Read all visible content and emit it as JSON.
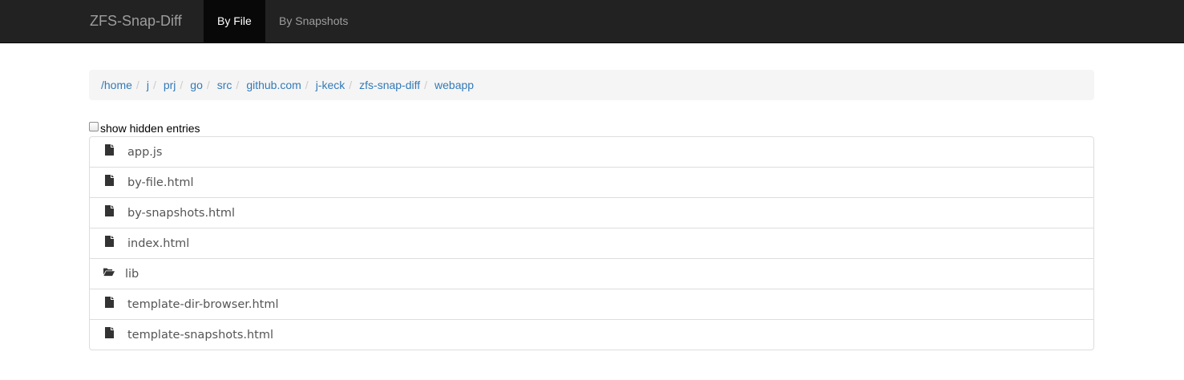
{
  "navbar": {
    "brand": "ZFS-Snap-Diff",
    "tabs": [
      {
        "label": "By File",
        "active": true
      },
      {
        "label": "By Snapshots",
        "active": false
      }
    ]
  },
  "breadcrumb": {
    "items": [
      "/home",
      "j",
      "prj",
      "go",
      "src",
      "github.com",
      "j-keck",
      "zfs-snap-diff",
      "webapp"
    ],
    "separator": "/"
  },
  "hidden_toggle": {
    "label": "show hidden entries",
    "checked": false
  },
  "entries": [
    {
      "name": "app.js",
      "icon": "file-icon"
    },
    {
      "name": "by-file.html",
      "icon": "file-icon"
    },
    {
      "name": "by-snapshots.html",
      "icon": "file-icon"
    },
    {
      "name": "index.html",
      "icon": "file-icon"
    },
    {
      "name": "lib",
      "icon": "folder-open-icon"
    },
    {
      "name": "template-dir-browser.html",
      "icon": "file-icon"
    },
    {
      "name": "template-snapshots.html",
      "icon": "file-icon"
    }
  ],
  "colors": {
    "navbar_bg": "#222222",
    "active_tab_bg": "#080808",
    "link": "#337ab7",
    "breadcrumb_bg": "#f5f5f5"
  }
}
